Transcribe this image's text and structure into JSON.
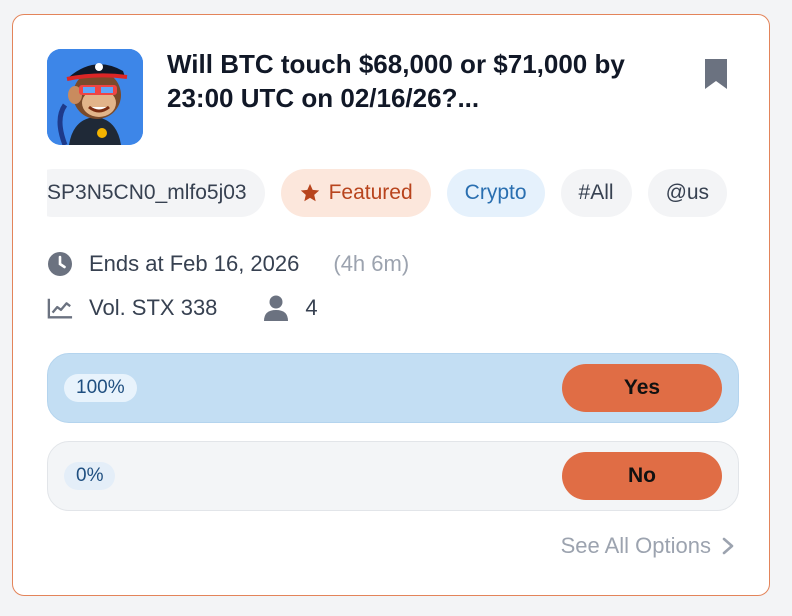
{
  "card": {
    "title": "Will BTC touch $68,000 or $71,000 by 23:00 UTC on 02/16/26?...",
    "avatar_icon": "pirate-monkey-avatar",
    "bookmark_icon": "bookmark-icon",
    "tags": [
      {
        "label": "SP3N5CN0_mlfo5j03",
        "style": "gray"
      },
      {
        "label": "Featured",
        "style": "featured",
        "icon": "star-icon"
      },
      {
        "label": "Crypto",
        "style": "crypto"
      },
      {
        "label": "#All",
        "style": "gray"
      },
      {
        "label": "@us",
        "style": "gray"
      }
    ],
    "ends_label": "Ends at Feb 16, 2026",
    "remaining": "(4h 6m)",
    "volume": "Vol. STX 338",
    "participants": "4",
    "outcomes": [
      {
        "percent": "100%",
        "label": "Yes",
        "share": 1.0
      },
      {
        "percent": "0%",
        "label": "No",
        "share": 0.0
      }
    ],
    "see_all": "See All Options"
  },
  "colors": {
    "accent": "#e06d45",
    "card_border": "#e3845a",
    "yes_fill": "#c3def3",
    "featured_bg": "#fce7dc",
    "crypto_bg": "#e5f1fc"
  }
}
